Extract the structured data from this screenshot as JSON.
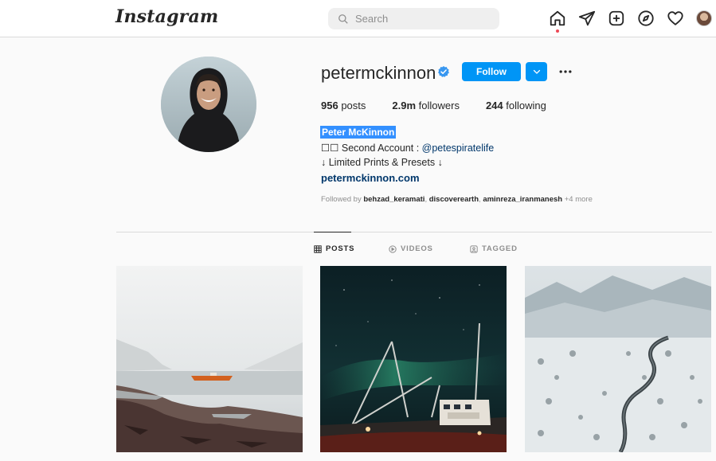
{
  "topbar": {
    "logo": "Instagram",
    "search_placeholder": "Search",
    "icons": [
      "home-icon",
      "direct-icon",
      "new-post-icon",
      "explore-icon",
      "activity-icon",
      "profile-avatar"
    ]
  },
  "profile": {
    "username": "petermckinnon",
    "verified": true,
    "follow_label": "Follow",
    "stats": {
      "posts_count": "956",
      "posts_label": " posts",
      "followers_count": "2.9m",
      "followers_label": " followers",
      "following_count": "244",
      "following_label": " following"
    },
    "full_name": "Peter McKinnon",
    "bio": {
      "line1_prefix": "☐☐ Second Account : ",
      "line1_handle": "@petespiratelife",
      "line2": "↓ Limited Prints & Presets ↓"
    },
    "website": "petermckinnon.com",
    "followed_by": {
      "prefix": "Followed by ",
      "user1": "behzad_keramati",
      "user2": "discoverearth",
      "user3": "aminreza_iranmanesh",
      "sep": ", ",
      "more": " +4 more"
    }
  },
  "tabs": {
    "posts": "POSTS",
    "videos": "VIDEOS",
    "tagged": "TAGGED",
    "active": "posts"
  },
  "posts": [
    {
      "subject": "foggy shoreline with orange boat"
    },
    {
      "subject": "fishing boat under northern lights"
    },
    {
      "subject": "winding road through snowy forest"
    }
  ],
  "colors": {
    "accent": "#0095f6",
    "link": "#00376b",
    "notification_dot": "#ed4956",
    "verified": "#3897f0"
  }
}
